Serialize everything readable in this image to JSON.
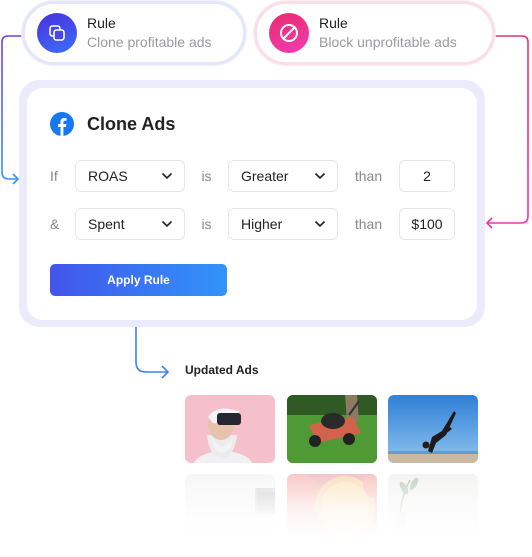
{
  "rules": [
    {
      "icon": "clone-icon",
      "title": "Rule",
      "subtitle": "Clone profitable ads",
      "color": "#4a3ae6"
    },
    {
      "icon": "block-icon",
      "title": "Rule",
      "subtitle": "Block unprofitable ads",
      "color": "#ee2f86"
    }
  ],
  "card": {
    "platform_icon": "facebook-icon",
    "title": "Clone Ads",
    "conditions": [
      {
        "connector": "If",
        "metric": "ROAS",
        "verb": "is",
        "operator": "Greater",
        "than": "than",
        "value": "2"
      },
      {
        "connector": "&",
        "metric": "Spent",
        "verb": "is",
        "operator": "Higher",
        "than": "than",
        "value": "$100"
      }
    ],
    "apply_label": "Apply Rule"
  },
  "updated_ads": {
    "title": "Updated Ads",
    "thumbnails": [
      {
        "name": "vr-headset-man"
      },
      {
        "name": "lawn-mower"
      },
      {
        "name": "yoga-pose-beach"
      },
      {
        "name": "laptop-desk"
      },
      {
        "name": "citrus-slices"
      },
      {
        "name": "plant-vase"
      }
    ]
  },
  "colors": {
    "accent_blue": "#3b82f6",
    "accent_purple": "#5b3ee6",
    "accent_pink": "#ee2f86",
    "facebook": "#1877f2"
  }
}
